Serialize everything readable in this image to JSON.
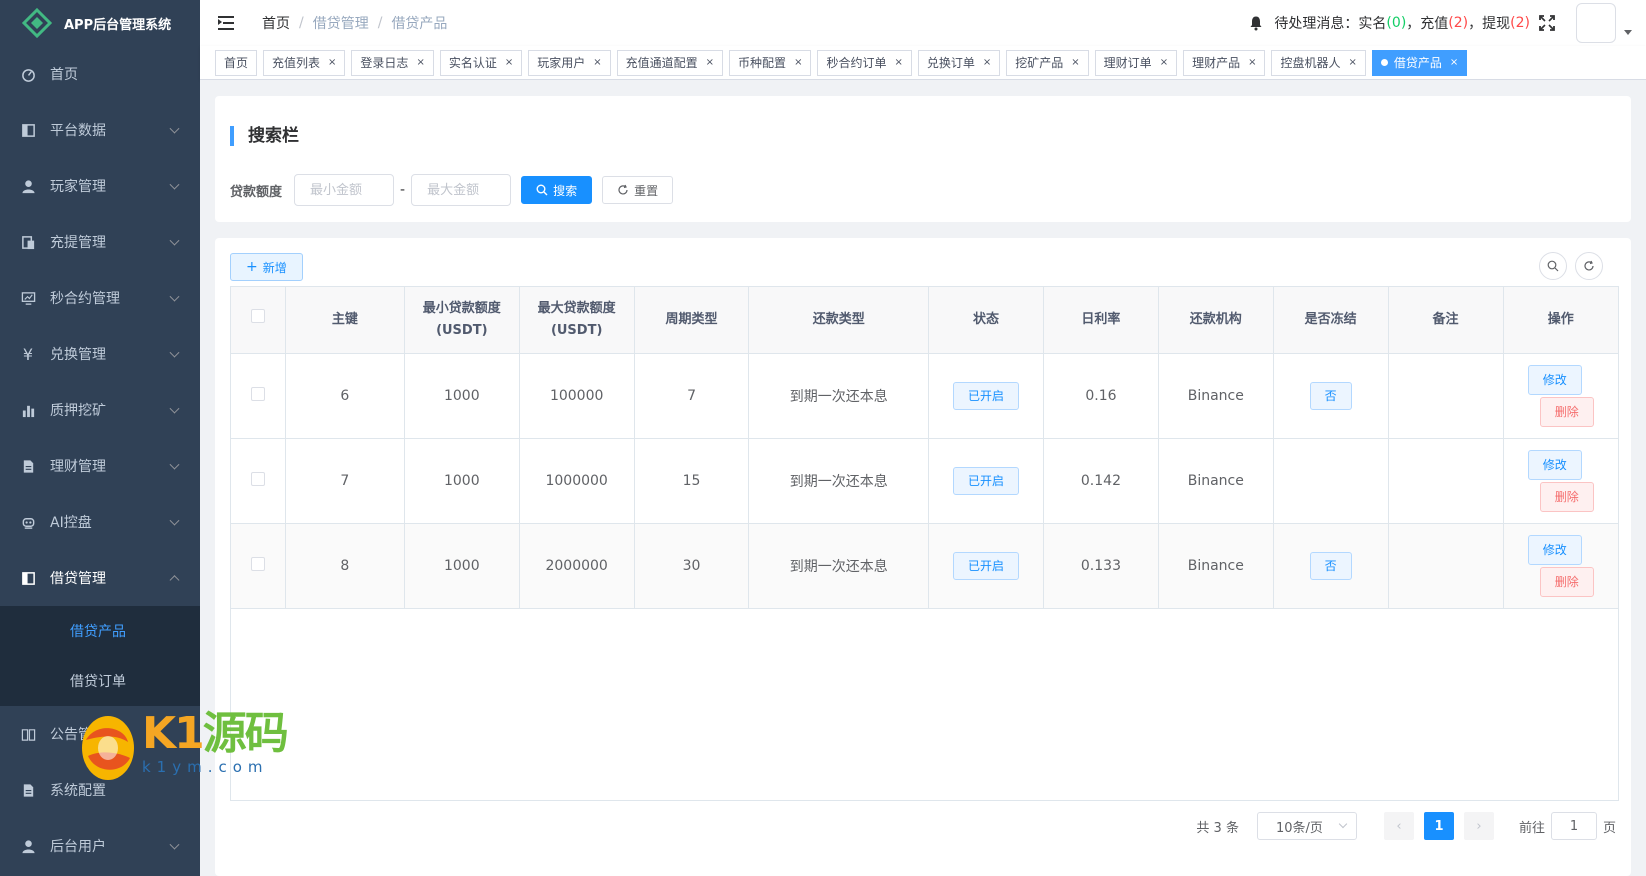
{
  "app": {
    "title": "APP后台管理系统"
  },
  "sidebar": {
    "items": [
      {
        "label": "首页",
        "icon": "dashboard-icon"
      },
      {
        "label": "平台数据",
        "icon": "book-icon"
      },
      {
        "label": "玩家管理",
        "icon": "user-icon"
      },
      {
        "label": "充提管理",
        "icon": "clipboard-icon"
      },
      {
        "label": "秒合约管理",
        "icon": "monitor-icon"
      },
      {
        "label": "兑换管理",
        "icon": "yen-icon"
      },
      {
        "label": "质押挖矿",
        "icon": "bar-chart-icon"
      },
      {
        "label": "理财管理",
        "icon": "document-icon"
      },
      {
        "label": "AI控盘",
        "icon": "robot-icon"
      },
      {
        "label": "借贷管理",
        "icon": "book-open-icon"
      }
    ],
    "sub_items": [
      {
        "label": "借贷产品"
      },
      {
        "label": "借贷订单"
      }
    ],
    "items_after": [
      {
        "label": "公告管理",
        "icon": "reading-icon"
      },
      {
        "label": "系统配置",
        "icon": "settings-doc-icon"
      },
      {
        "label": "后台用户",
        "icon": "admin-user-icon"
      }
    ]
  },
  "breadcrumb": [
    "首页",
    "借贷管理",
    "借贷产品"
  ],
  "notice": {
    "prefix": "待处理消息：实名",
    "realname_count": "0",
    "recharge_label": "，充值",
    "recharge_count": "2",
    "withdraw_label": "，提现",
    "withdraw_count": "2",
    "open_paren": "(",
    "close_paren": ")"
  },
  "tags": [
    "首页",
    "充值列表",
    "登录日志",
    "实名认证",
    "玩家用户",
    "充值通道配置",
    "币种配置",
    "秒合约订单",
    "兑换订单",
    "挖矿产品",
    "理财订单",
    "理财产品",
    "控盘机器人",
    "借贷产品"
  ],
  "search": {
    "title": "搜索栏",
    "label": "贷款额度",
    "min_placeholder": "最小金额",
    "max_placeholder": "最大金额",
    "dash": "-",
    "search_label": "搜索",
    "reset_label": "重置"
  },
  "toolbar": {
    "add_label": "新增"
  },
  "table": {
    "headers": [
      "主键",
      "最小贷款额度(USDT)",
      "最大贷款额度(USDT)",
      "周期类型",
      "还款类型",
      "状态",
      "日利率",
      "还款机构",
      "是否冻结",
      "备注",
      "操作"
    ],
    "rows": [
      {
        "id": "6",
        "min": "1000",
        "max": "100000",
        "cycle": "7",
        "repay": "到期一次还本息",
        "status": "已开启",
        "rate": "0.16",
        "org": "Binance",
        "frozen": "否",
        "remark": ""
      },
      {
        "id": "7",
        "min": "1000",
        "max": "1000000",
        "cycle": "15",
        "repay": "到期一次还本息",
        "status": "已开启",
        "rate": "0.142",
        "org": "Binance",
        "frozen": "",
        "remark": ""
      },
      {
        "id": "8",
        "min": "1000",
        "max": "2000000",
        "cycle": "30",
        "repay": "到期一次还本息",
        "status": "已开启",
        "rate": "0.133",
        "org": "Binance",
        "frozen": "否",
        "remark": ""
      }
    ],
    "edit_label": "修改",
    "delete_label": "删除"
  },
  "pagination": {
    "total": "共 3 条",
    "page_size": "10条/页",
    "current_page": "1",
    "goto_prefix": "前往",
    "goto_value": "1",
    "goto_suffix": "页"
  },
  "watermark": {
    "brand_k": "K",
    "brand_1": "1",
    "brand_cn": "源码",
    "domain": "k1ym.com"
  }
}
